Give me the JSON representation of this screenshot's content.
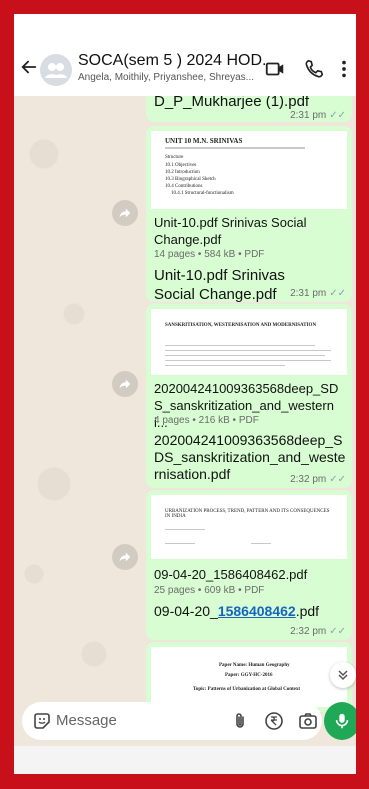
{
  "colors": {
    "frame": "#c8101b",
    "bubble": "#d9fdd3",
    "accent": "#1fa855",
    "link": "#1565c0"
  },
  "header": {
    "title": "SOCA(sem 5 ) 2024  HOD...",
    "members": "Angela, Moithily, Priyanshee, Shreyas...",
    "icons": [
      "back-arrow-icon",
      "group-avatar-icon",
      "video-call-icon",
      "voice-call-icon",
      "more-options-icon"
    ]
  },
  "messages": [
    {
      "partial_caption": "D_P_Mukharjee (1).pdf",
      "time": "2:31 pm",
      "ticks": "✓✓"
    },
    {
      "preview_heading": "UNIT 10  M.N. SRINIVAS",
      "preview_lines": [
        "Structure",
        "10.1 Objectives",
        "10.2 Introduction",
        "10.3 Biographical Sketch",
        "10.4 Contributions",
        "10.4.1 Structural-functionalism"
      ],
      "file_name": "Unit-10.pdf Srinivas Social Change.pdf",
      "meta": "14 pages • 584 kB • PDF",
      "caption": "Unit-10.pdf Srinivas Social Change.pdf",
      "time": "2:31 pm",
      "ticks": "✓✓"
    },
    {
      "preview_heading": "SANSKRITISATION, WESTERNISATION AND MODERNISATION",
      "file_name": "202004241009363568deep_SDS_sanskritization_and_westerni...",
      "meta": "4 pages • 216 kB • PDF",
      "caption": "202004241009363568deep_SDS_sanskritization_and_westernisation.pdf",
      "time": "2:32 pm",
      "ticks": "✓✓"
    },
    {
      "preview_heading": "URBANIZATION PROCESS, TREND, PATTERN AND ITS CONSEQUENCES IN INDIA",
      "file_name": "09-04-20_1586408462.pdf",
      "meta": "25 pages • 609 kB • PDF",
      "caption_prefix": "09-04-20_",
      "caption_link": "1586408462",
      "caption_suffix": ".pdf",
      "time": "2:32 pm",
      "ticks": "✓✓"
    },
    {
      "preview_lines": [
        "Paper Name: Human Geography",
        "Paper: GGY-HC-2016",
        "Topic: Patterns of Urbanization at Global Context"
      ]
    }
  ],
  "input": {
    "placeholder": "Message"
  }
}
